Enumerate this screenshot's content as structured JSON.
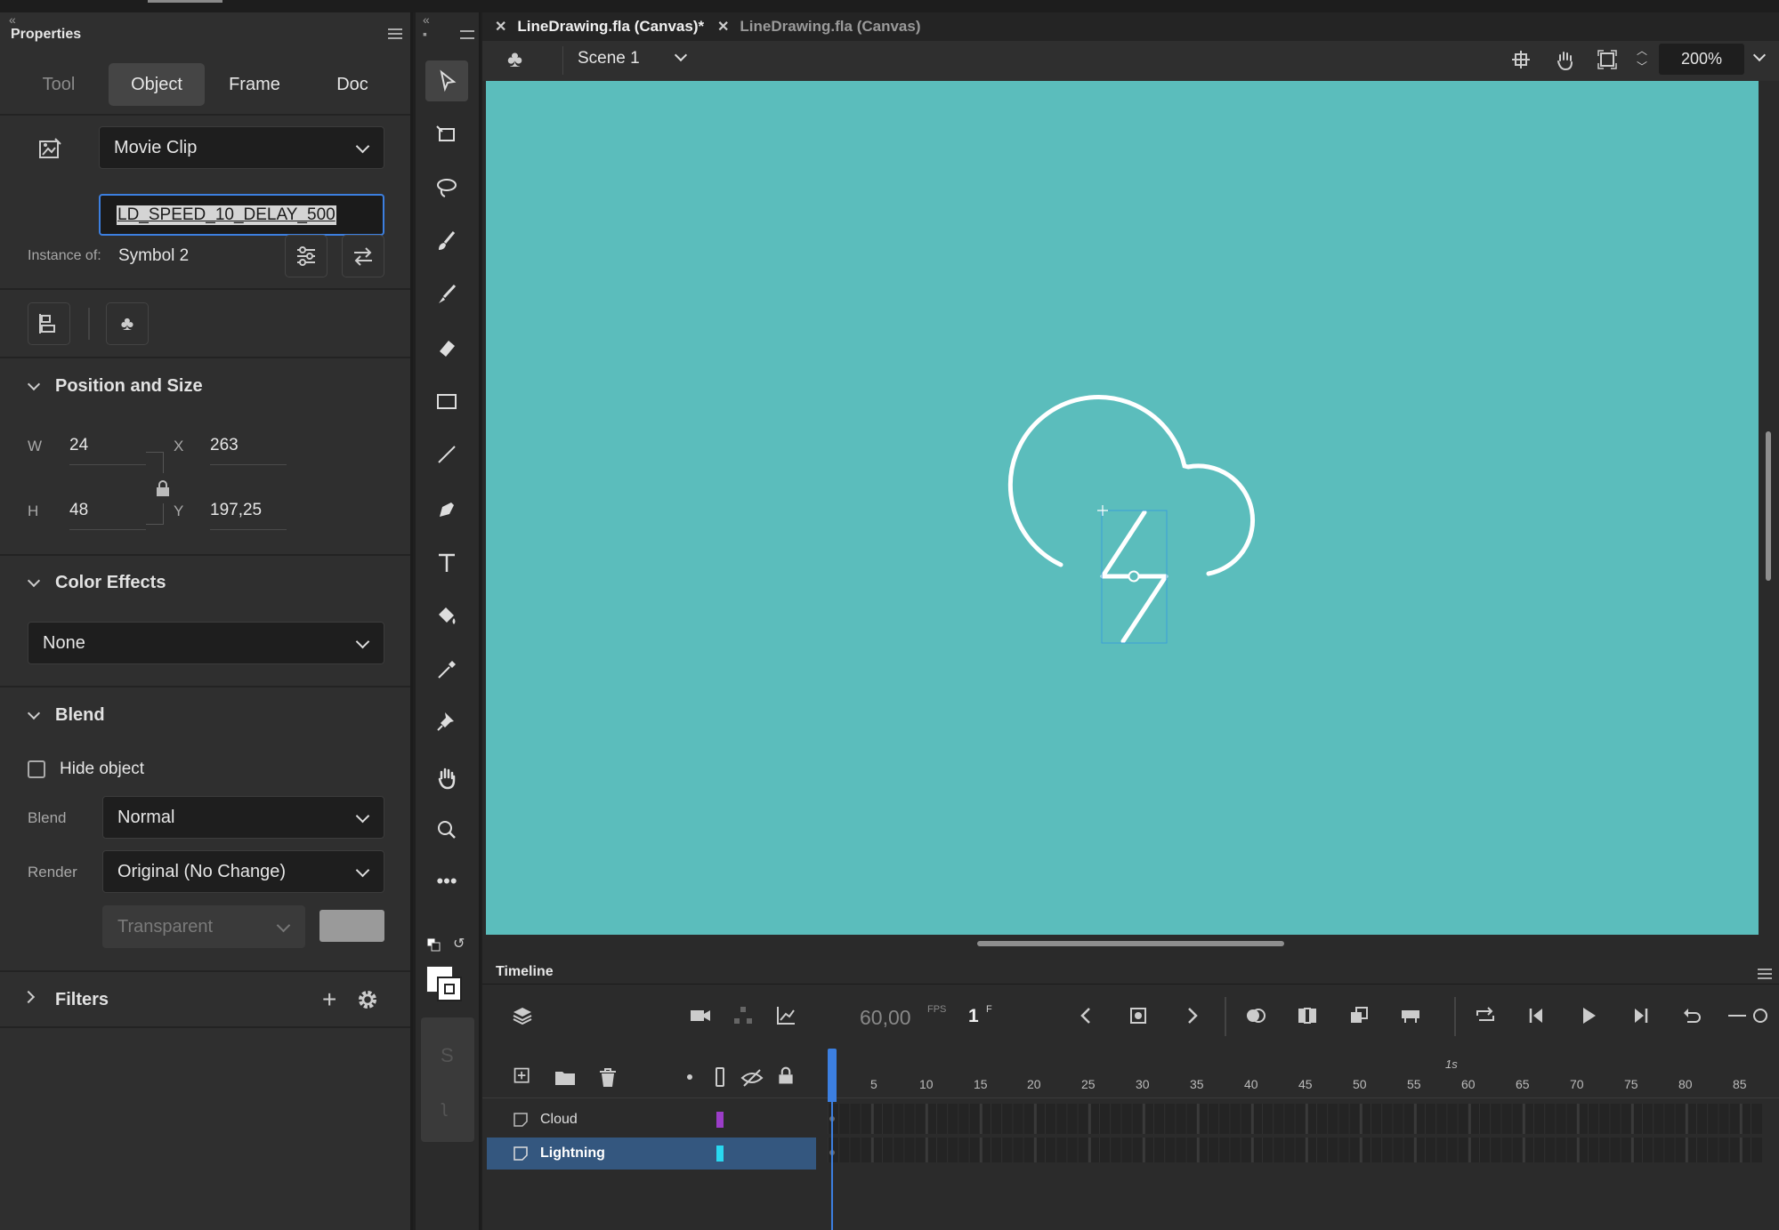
{
  "properties": {
    "title": "Properties",
    "tabs": [
      "Tool",
      "Object",
      "Frame",
      "Doc"
    ],
    "active_tab": "Object",
    "symbol_type": "Movie Clip",
    "instance_name": "LD_SPEED_10_DELAY_500",
    "instance_of_label": "Instance of:",
    "instance_of_value": "Symbol 2",
    "position_size": {
      "title": "Position and Size",
      "w_label": "W",
      "w_value": "24",
      "h_label": "H",
      "h_value": "48",
      "x_label": "X",
      "x_value": "263",
      "y_label": "Y",
      "y_value": "197,25"
    },
    "color_effects": {
      "title": "Color Effects",
      "value": "None"
    },
    "blend": {
      "title": "Blend",
      "hide_object": "Hide object",
      "blend_label": "Blend",
      "blend_value": "Normal",
      "render_label": "Render",
      "render_value": "Original (No Change)",
      "transparent": "Transparent"
    },
    "filters": {
      "title": "Filters"
    }
  },
  "documents": {
    "tabs": [
      {
        "label": "LineDrawing.fla (Canvas)*",
        "active": true
      },
      {
        "label": "LineDrawing.fla (Canvas)",
        "active": false
      }
    ]
  },
  "editbar": {
    "scene": "Scene 1",
    "zoom": "200%"
  },
  "stage": {
    "background": "#5bbdbc"
  },
  "timeline": {
    "title": "Timeline",
    "fps": "60,00",
    "fps_unit": "FPS",
    "frame": "1",
    "frame_unit": "F",
    "ruler_marker": "1s",
    "ruler_numbers": [
      "5",
      "10",
      "15",
      "20",
      "25",
      "30",
      "35",
      "40",
      "45",
      "50",
      "55",
      "60",
      "65",
      "70",
      "75",
      "80",
      "85"
    ],
    "layers": [
      {
        "name": "Cloud",
        "color": "#9b3dc8",
        "selected": false
      },
      {
        "name": "Lightning",
        "color": "#29d8f0",
        "selected": true
      }
    ]
  },
  "colors": {
    "accent": "#3c7fe0",
    "selected_layer": "#34577f"
  }
}
